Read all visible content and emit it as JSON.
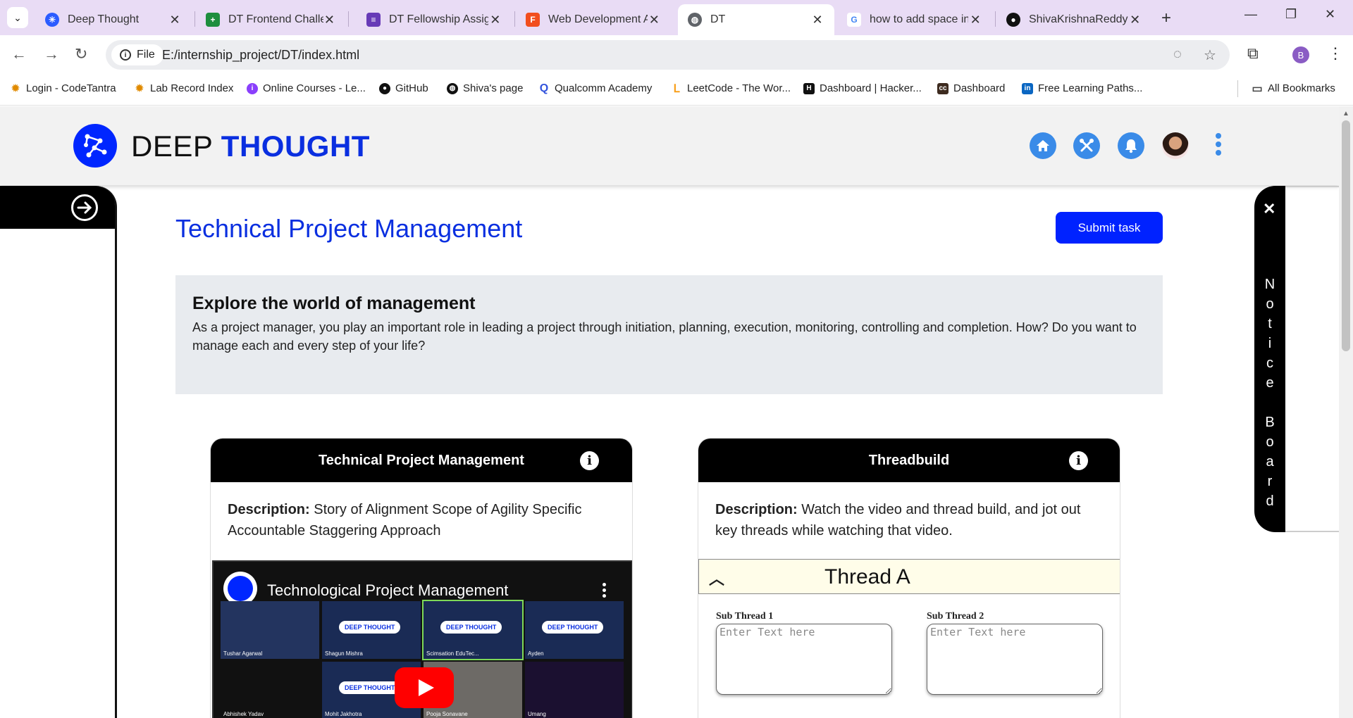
{
  "browser": {
    "tabs": [
      {
        "title": "Deep Thought",
        "color": "#2b5cff"
      },
      {
        "title": "DT Frontend Challeng",
        "color": "#1e8e3e"
      },
      {
        "title": "DT Fellowship Assign",
        "color": "#673ab7"
      },
      {
        "title": "Web Development A",
        "color": "#f24e1e"
      },
      {
        "title": "DT",
        "color": "#5f6368"
      },
      {
        "title": "how to add space in",
        "color": "#4285f4"
      },
      {
        "title": "ShivaKrishnaReddyB",
        "color": "#111111"
      }
    ],
    "address": {
      "scheme_label": "File",
      "url": "E:/internship_project/DT/index.html"
    },
    "profile_initial": "B",
    "bookmarks": [
      "Login - CodeTantra",
      "Lab Record Index",
      "Online Courses - Le...",
      "GitHub",
      "Shiva's page",
      "Qualcomm Academy",
      "LeetCode - The Wor...",
      "Dashboard | Hacker...",
      "Dashboard",
      "Free Learning Paths..."
    ],
    "all_bookmarks": "All Bookmarks"
  },
  "site": {
    "brand_part1": "DEEP",
    "brand_part2": "THOUGHT",
    "brand_color": "#0a2fe0",
    "header_icons": [
      "home-icon",
      "tools-icon",
      "bell-icon"
    ]
  },
  "main": {
    "title": "Technical Project Management",
    "submit_label": "Submit task",
    "intro_heading": "Explore the world of management",
    "intro_text": "As a project manager, you play an important role in leading a project through initiation, planning, execution, monitoring, controlling and completion. How? Do you want to manage each and every step of your life?"
  },
  "card1": {
    "title": "Technical Project Management",
    "desc_label": "Description:",
    "desc_text": "Story of Alignment Scope of Agility Specific Accountable Staggering Approach",
    "video_title": "Technological Project Management",
    "participants": [
      "Tushar Agarwal",
      "Shagun Mishra",
      "Scimsation EduTec...",
      "Ayden",
      "Abhishek Yadav",
      "Mohit Jakhotra",
      "Pooja Sonavane",
      "Umang"
    ],
    "badge": "DEEP THOUGHT"
  },
  "card2": {
    "title": "Threadbuild",
    "desc_label": "Description:",
    "desc_text": "Watch the video and thread build, and jot out key threads while watching that video.",
    "thread_title": "Thread A",
    "sub1_label": "Sub Thread 1",
    "sub2_label": "Sub Thread 2",
    "placeholder": "Enter Text here"
  },
  "notice": {
    "label": "Notice Board"
  }
}
